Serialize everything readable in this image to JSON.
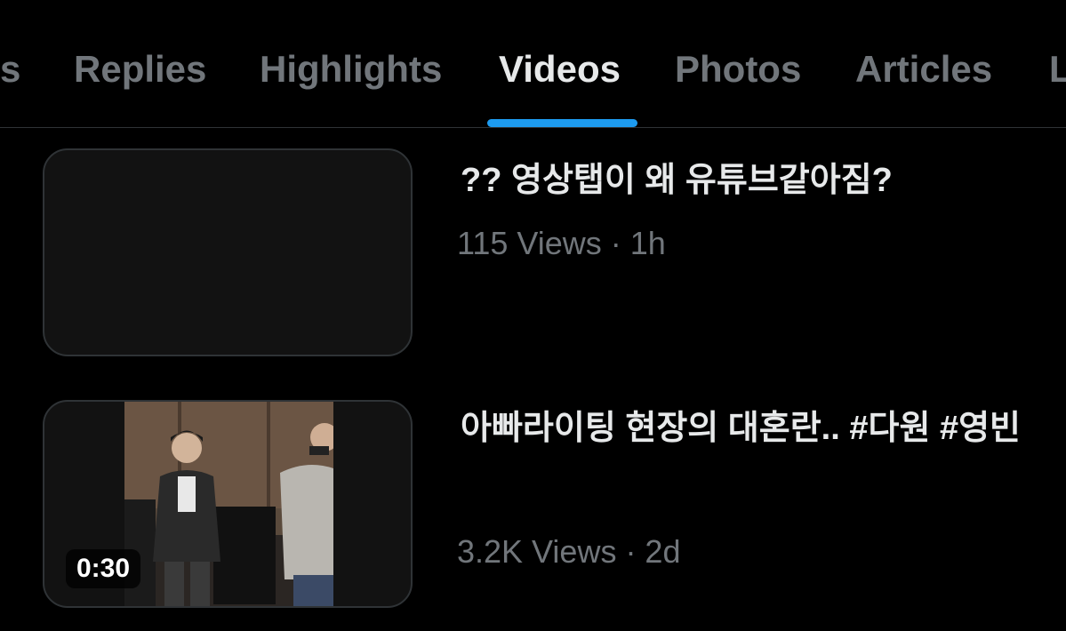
{
  "tabs": [
    {
      "label": "ts"
    },
    {
      "label": "Replies"
    },
    {
      "label": "Highlights"
    },
    {
      "label": "Videos",
      "active": true
    },
    {
      "label": "Photos"
    },
    {
      "label": "Articles"
    },
    {
      "label": "L"
    }
  ],
  "videos": [
    {
      "title": "?? 영상탭이 왜 유튜브같아짐?",
      "meta": "115 Views · 1h",
      "duration": ""
    },
    {
      "title": "아빠라이팅 현장의 대혼란.. #다원 #영빈",
      "meta": "3.2K Views · 2d",
      "duration": "0:30"
    }
  ],
  "colors": {
    "accent": "#1d9bf0",
    "text_primary": "#e7e9ea",
    "text_secondary": "#71767b",
    "background": "#000000",
    "divider": "#2f3336"
  }
}
